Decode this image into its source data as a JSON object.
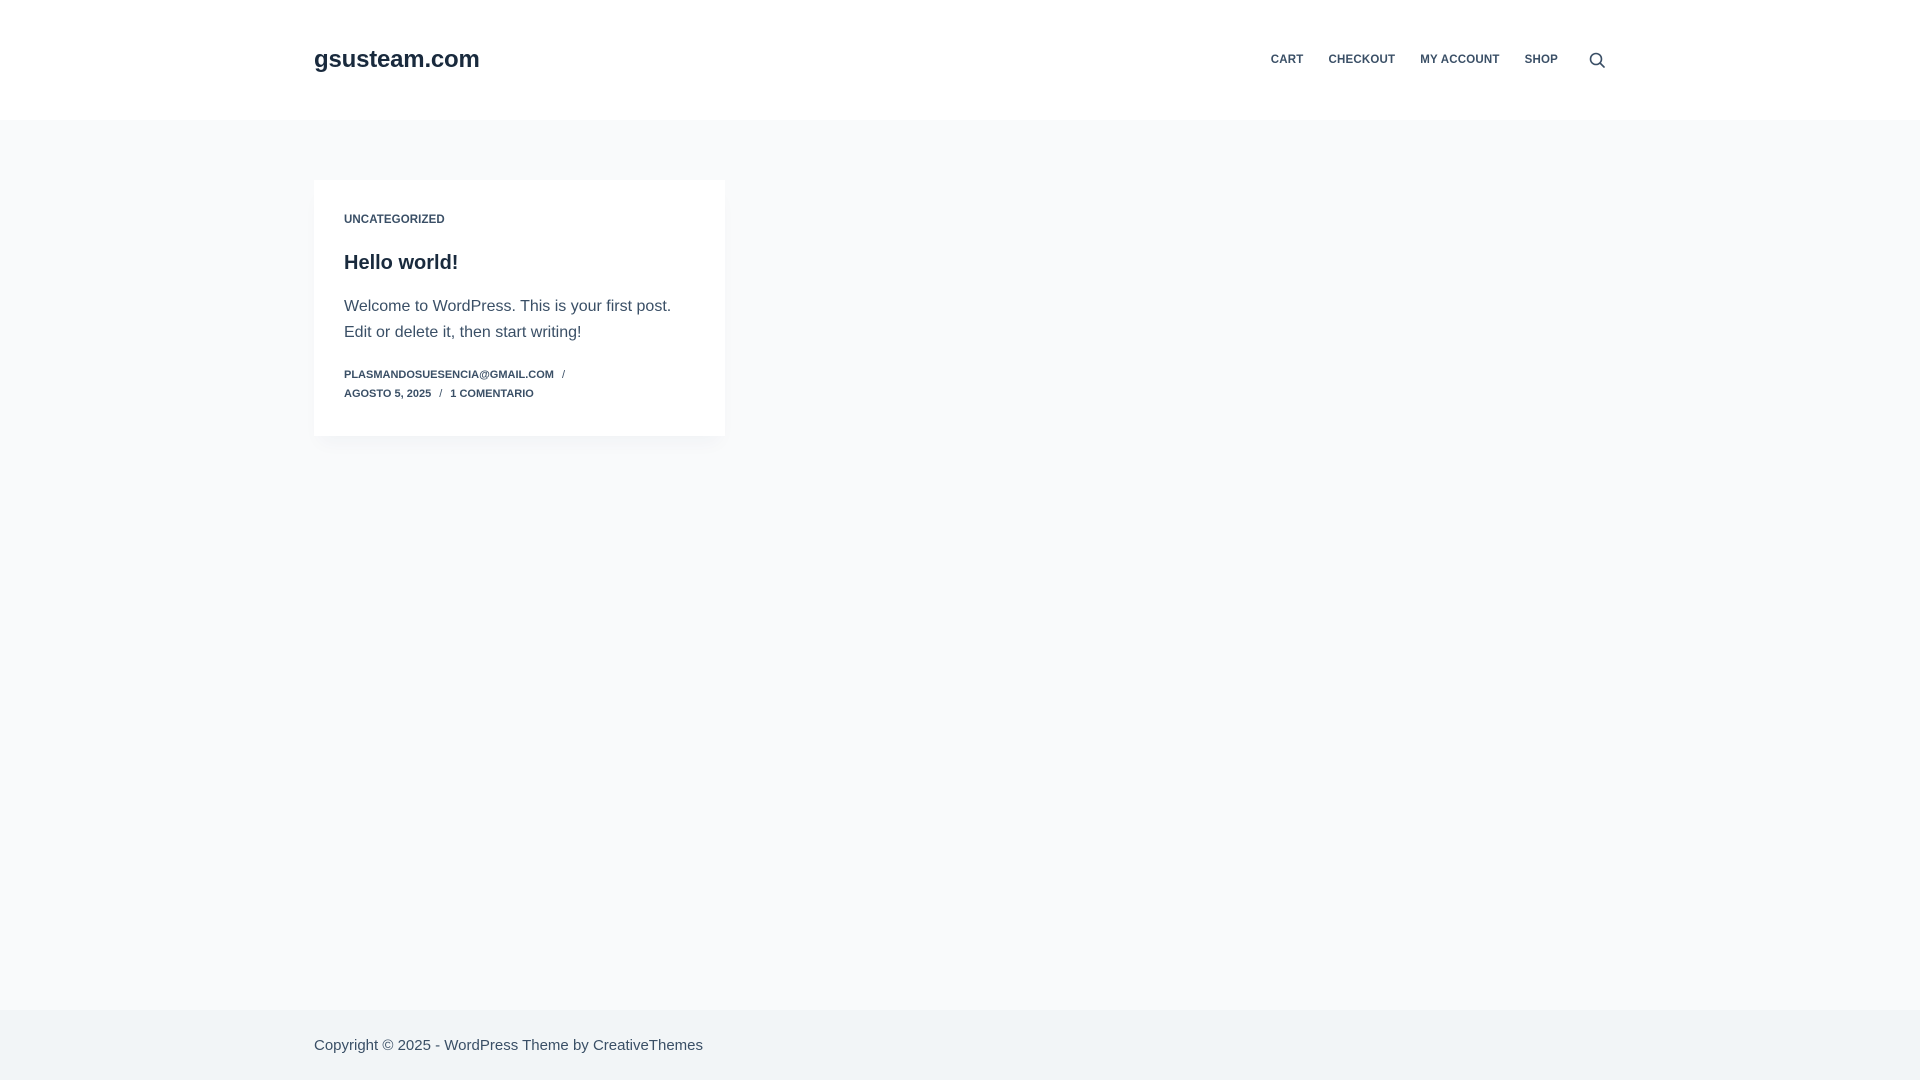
{
  "header": {
    "site_title": "gsusteam.com",
    "menu": [
      {
        "label": "CART"
      },
      {
        "label": "CHECKOUT"
      },
      {
        "label": "MY ACCOUNT"
      },
      {
        "label": "SHOP"
      }
    ],
    "search_icon": "search-icon"
  },
  "post": {
    "category": "UNCATEGORIZED",
    "title": "Hello world!",
    "excerpt": "Welcome to WordPress. This is your first post. Edit or delete it, then start writing!",
    "meta": {
      "author": "PLASMANDOSUESENCIA@GMAIL.COM",
      "separator": "/",
      "date": "AGOSTO 5, 2025",
      "comments": "1 COMENTARIO"
    }
  },
  "footer": {
    "copyright_prefix": "Copyright © 2025 - WordPress Theme by ",
    "theme_author": "CreativeThemes"
  },
  "colors": {
    "background": "#f9fafb",
    "header_bg": "#ffffff",
    "footer_bg": "#f2f5f7",
    "heading": "#192a3d",
    "text": "#3a4f66"
  }
}
